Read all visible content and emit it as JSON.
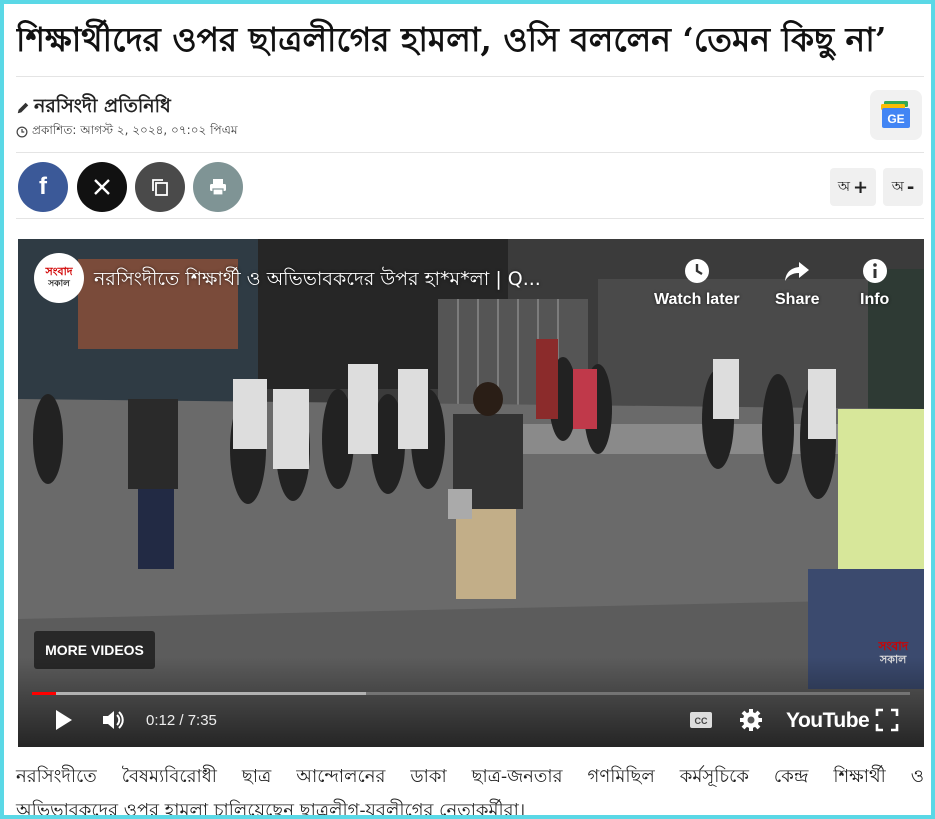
{
  "article": {
    "headline": "শিক্ষার্থীদের ওপর ছাত্রলীগের হামলা, ওসি বললেন ‘তেমন কিছু না’",
    "byline": "নরসিংদী প্রতিনিধি",
    "published_label": "প্রকাশিত: আগস্ট ২, ২০২৪, ০৭:০২ পিএম",
    "body_first_line": "নরসিংদীতে বৈষম্যবিরোধী ছাত্র আন্দোলনের ডাকা ছাত্র-জনতার গণমিছিল কর্মসূচিকে কেন্দ্র শিক্ষার্থী ও",
    "body_second_line": "অভিভাবকদের ওপর হামলা চালিয়েছেন ছাত্রলীগ-যুবলীগের নেতাকর্মীরা।"
  },
  "icons": {
    "author": "pencil-icon",
    "published": "clock-icon",
    "google_news": "google-news-icon"
  },
  "google_news_label": "GE",
  "share": {
    "facebook": {
      "label": "f",
      "color": "#3b5998"
    },
    "x": {
      "label": "𝕏",
      "color": "#111111"
    },
    "copy": {
      "color": "#4a4a4a"
    },
    "print": {
      "color": "#7f9495"
    }
  },
  "font_controls": {
    "increase": {
      "letter": "অ",
      "symbol": "+"
    },
    "decrease": {
      "letter": "অ",
      "symbol": "-"
    }
  },
  "video": {
    "title": "নরসিংদীতে শিক্ষার্থী ও অভিভাবকদের উপর হা*ম*লা | Q...",
    "channel_logo_top": "সংবাদ",
    "channel_logo_bottom": "সকাল",
    "watch_later": "Watch later",
    "share": "Share",
    "info": "Info",
    "more_videos": "MORE VIDEOS",
    "watermark_top": "সংবাদ",
    "watermark_bottom": "সকাল",
    "time": "0:12 / 7:35",
    "progress_played": 0.027,
    "progress_buffered": 0.38,
    "brand": "YouTube"
  },
  "colors": {
    "frame_border": "#5ad8e6",
    "progress_red": "#ff0000"
  }
}
